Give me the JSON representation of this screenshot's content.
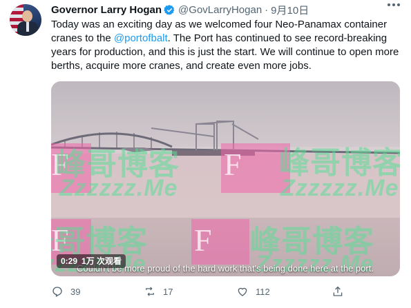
{
  "tweet": {
    "author": "Governor Larry Hogan",
    "handle": "@GovLarryHogan",
    "separator": "·",
    "date": "9月10日",
    "text_before": "Today was an exciting day as we welcomed four Neo-Panamax container cranes to the ",
    "mention": "@portofbalt",
    "text_after": ". The Port has continued to see record-breaking years for production, and this is just the start. We will continue to open more berths, acquire more cranes, and create even more jobs."
  },
  "video": {
    "time": "0:29",
    "views": "1万 次观看",
    "caption": "Couldn't be more proud of the hard work that's being done here at the port."
  },
  "watermark": {
    "chinese": "峰哥博客",
    "latin": "Zzzzzz.Me",
    "letter": "F"
  },
  "actions": {
    "replies": "39",
    "retweets": "17",
    "likes": "112"
  },
  "colors": {
    "link": "#1d9bf0",
    "secondary": "#536471",
    "verified": "#1d9bf0"
  }
}
